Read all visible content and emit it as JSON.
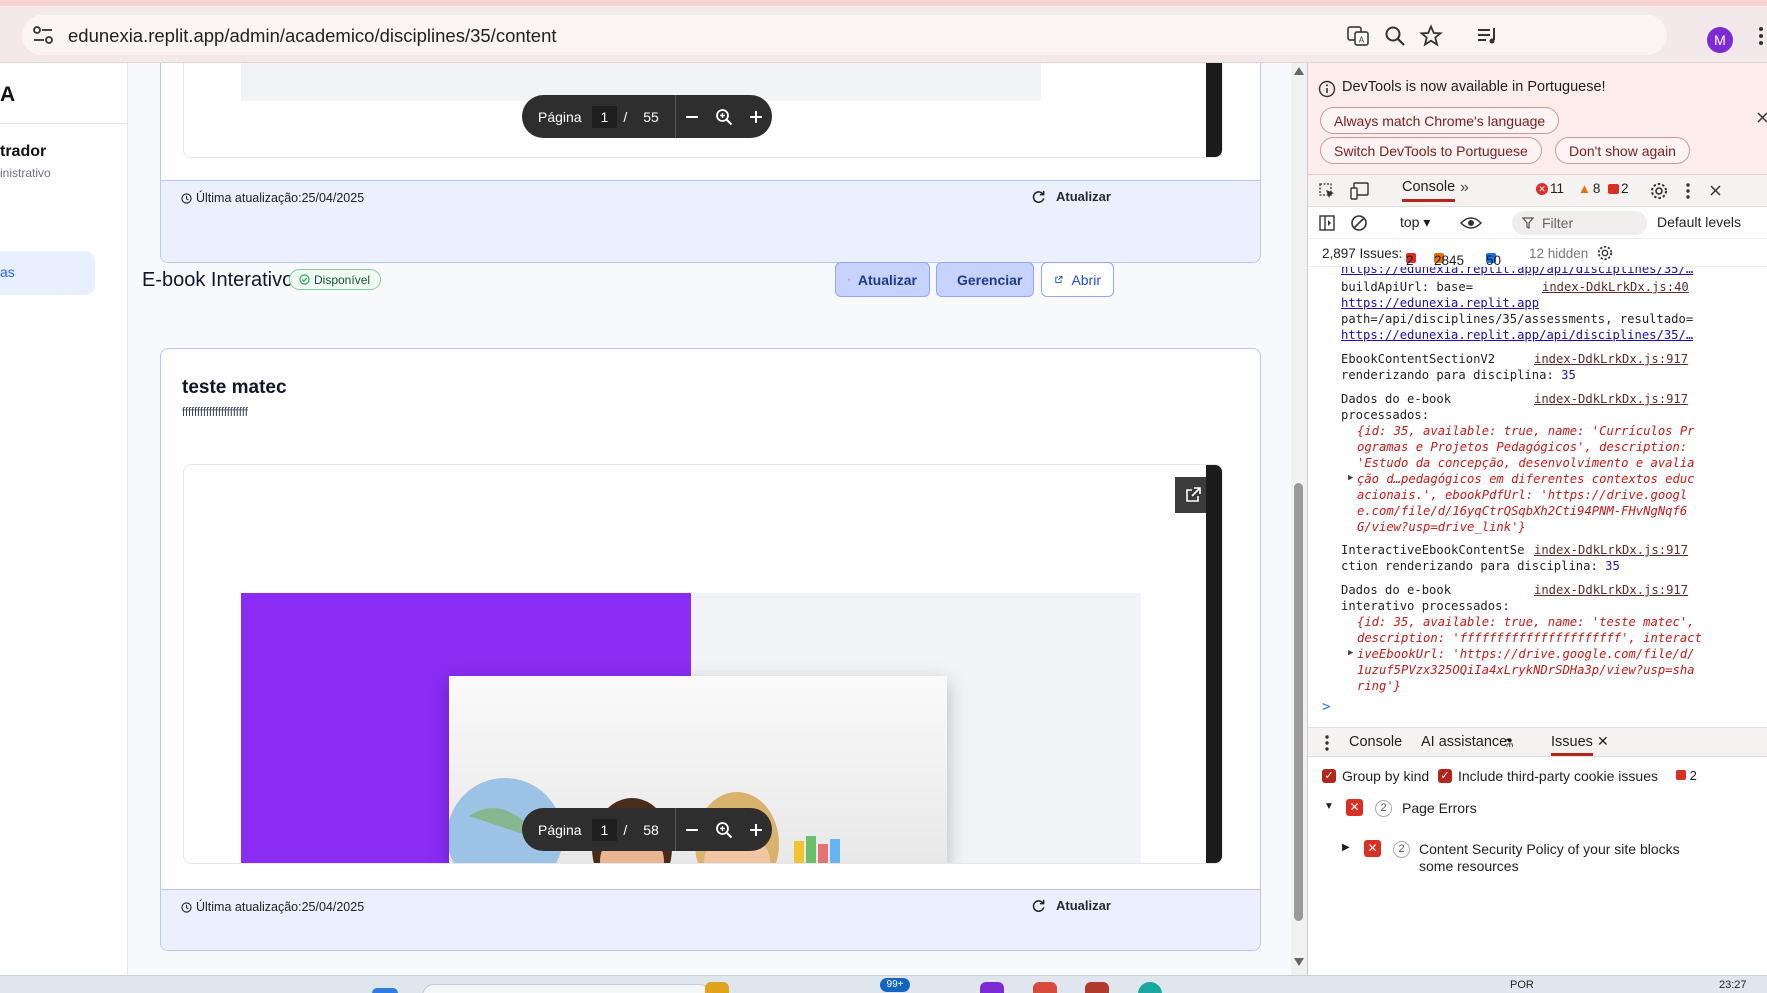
{
  "browser": {
    "url": "edunexia.replit.app/admin/academico/disciplines/35/content",
    "profile_initial": "M",
    "icons": [
      "site-settings-icon",
      "translate-icon",
      "zoom-icon",
      "bookmark-star-icon",
      "media-control-icon",
      "menu-icon"
    ]
  },
  "sidebar": {
    "brand_fragment": "A",
    "user_name_fragment": "trador",
    "user_role_fragment": "inistrativo",
    "active_item_fragment": "as"
  },
  "ebook_section": {
    "pdf_page_current": "1",
    "pdf_page_sep": "/",
    "pdf_page_total": "55",
    "pdf_page_label": "Página",
    "last_update": "Última atualização:25/04/2025",
    "refresh_label": "Atualizar"
  },
  "interactive_section": {
    "title": "E-book Interativo",
    "status_badge": "Disponível",
    "buttons": {
      "refresh": "Atualizar",
      "manage": "Gerenciar",
      "open": "Abrir"
    },
    "ebook_title": "teste matec",
    "ebook_description": "ffffffffffffffffffffff",
    "pdf_page_label": "Página",
    "pdf_page_current": "1",
    "pdf_page_sep": "/",
    "pdf_page_total": "58",
    "last_update": "Última atualização:25/04/2025",
    "refresh_label": "Atualizar"
  },
  "devtools": {
    "infobar": {
      "message": "DevTools is now available in Portuguese!",
      "btn_match": "Always match Chrome's language",
      "btn_switch": "Switch DevTools to Portuguese",
      "btn_dont_show": "Don't show again"
    },
    "tabs": {
      "console": "Console",
      "errors_count": "11",
      "warnings_count": "8",
      "issues_count": "2"
    },
    "toolbar": {
      "context": "top ▾",
      "filter_placeholder": "Filter",
      "levels": "Default levels"
    },
    "issues_bar": {
      "label": "2,897 Issues:",
      "errors": "2",
      "warnings": "2845",
      "info": "50",
      "hidden": "12 hidden"
    },
    "log": {
      "cut_top": "https://edunexia.replit.app/api/disciplines/35/…",
      "m1_text": "buildApiUrl: base=",
      "m1_src": "index-DdkLrkDx.js:40",
      "m1_link1": "https://edunexia.replit.app",
      "m1_mid": "path=/api/disciplines/35/assessments, resultado=",
      "m1_link2": "https://edunexia.replit.app/api/disciplines/35/…",
      "m2_l1": "EbookContentSectionV2",
      "m2_l2": "renderizando para disciplina: ",
      "m2_num": "35",
      "m2_src": "index-DdkLrkDx.js:917",
      "m3_l1": "Dados do e-book",
      "m3_l2": "processados:",
      "m3_src": "index-DdkLrkDx.js:917",
      "m3_obj": [
        "{id: 35, available: true, name: 'Currículos Pr",
        "ogramas e Projetos Pedagógicos', description:",
        "'Estudo da concepção, desenvolvimento e avalia",
        "ção d…pedagógicos em diferentes contextos educ",
        "acionais.', ebookPdfUrl: 'https://drive.googl",
        "e.com/file/d/16yqCtrQSqbXh2Cti94PNM-FHvNgNqf6",
        "G/view?usp=drive_link'}"
      ],
      "m4_l1": "InteractiveEbookContentSe",
      "m4_l2": "ction renderizando para disciplina: ",
      "m4_num": "35",
      "m4_src": "index-DdkLrkDx.js:917",
      "m5_l1": "Dados do e-book",
      "m5_l2": "interativo processados:",
      "m5_src": "index-DdkLrkDx.js:917",
      "m5_obj": [
        "{id: 35, available: true, name: 'teste matec',",
        "description: 'ffffffffffffffffffffff', interact",
        "iveEbookUrl: 'https://drive.google.com/file/d/",
        "1uzuf5PVzx325OQiIa4xLrykNDrSDHa3p/view?usp=sha",
        "ring'}"
      ],
      "prompt": ">"
    },
    "drawer": {
      "tab_console": "Console",
      "tab_ai": "AI assistance",
      "tab_issues": "Issues",
      "group_by_kind": "Group by kind",
      "third_party": "Include third-party cookie issues",
      "err_count": "2",
      "page_errors_count": "2",
      "page_errors": "Page Errors",
      "csp_count": "2",
      "csp_l1": "Content Security Policy of your site blocks",
      "csp_l2": "some resources"
    }
  },
  "taskbar": {
    "lang": "POR",
    "time": "23:27",
    "badge": "99+"
  },
  "colors": {
    "accent_blue": "#2563eb",
    "purple_cover": "#8b2cf5",
    "error_red": "#d93025",
    "warning_orange": "#e8710a"
  }
}
